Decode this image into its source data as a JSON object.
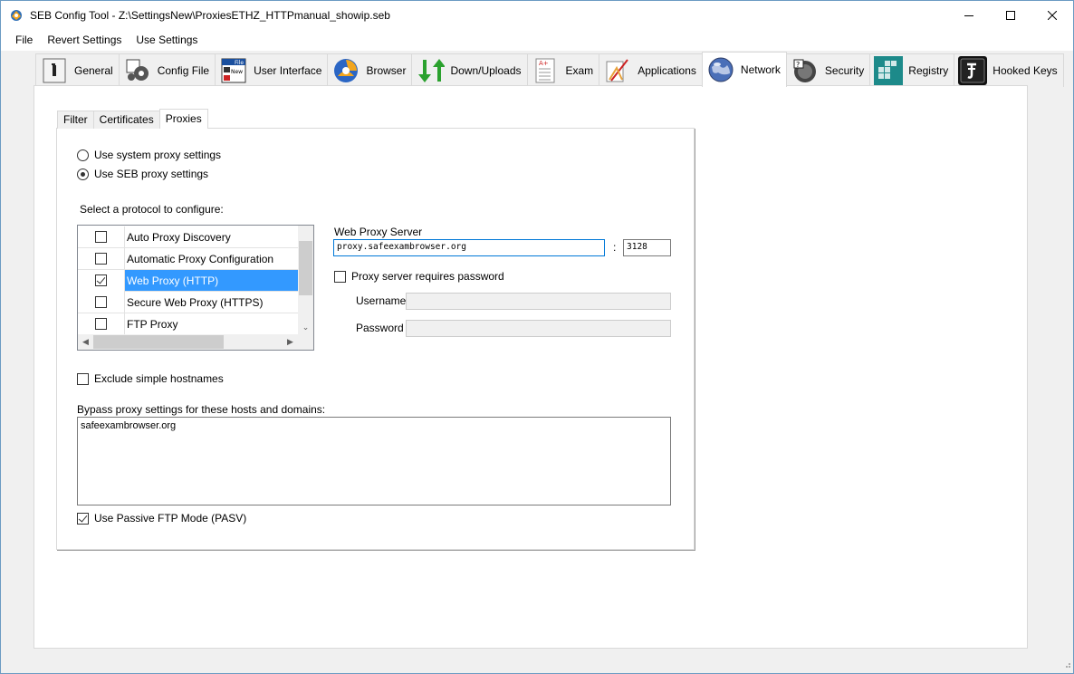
{
  "window": {
    "title": "SEB Config Tool - Z:\\SettingsNew\\ProxiesETHZ_HTTPmanual_showip.seb"
  },
  "menu": [
    "File",
    "Revert Settings",
    "Use Settings"
  ],
  "tabs": [
    {
      "label": "General",
      "icon": "general-icon"
    },
    {
      "label": "Config File",
      "icon": "config-file-icon"
    },
    {
      "label": "User Interface",
      "icon": "user-interface-icon"
    },
    {
      "label": "Browser",
      "icon": "browser-icon"
    },
    {
      "label": "Down/Uploads",
      "icon": "down-uploads-icon"
    },
    {
      "label": "Exam",
      "icon": "exam-icon"
    },
    {
      "label": "Applications",
      "icon": "applications-icon"
    },
    {
      "label": "Network",
      "icon": "network-icon",
      "active": true
    },
    {
      "label": "Security",
      "icon": "security-icon"
    },
    {
      "label": "Registry",
      "icon": "registry-icon"
    },
    {
      "label": "Hooked Keys",
      "icon": "hooked-keys-icon"
    }
  ],
  "subtabs": [
    "Filter",
    "Certificates",
    "Proxies"
  ],
  "proxies": {
    "radio_system": "Use system proxy settings",
    "radio_seb": "Use SEB proxy settings",
    "protocol_label": "Select a protocol to configure:",
    "protocols": [
      {
        "name": "Auto Proxy Discovery",
        "checked": false
      },
      {
        "name": "Automatic Proxy Configuration",
        "checked": false
      },
      {
        "name": "Web Proxy (HTTP)",
        "checked": true,
        "selected": true
      },
      {
        "name": "Secure Web Proxy (HTTPS)",
        "checked": false
      },
      {
        "name": "FTP Proxy",
        "checked": false
      }
    ],
    "server_label": "Web Proxy Server",
    "server_value": "proxy.safeexambrowser.org",
    "port_separator": ":",
    "port_value": "3128",
    "requires_password": "Proxy server requires password",
    "username_label": "Username",
    "password_label": "Password",
    "exclude_simple": "Exclude simple hostnames",
    "bypass_label": "Bypass proxy settings for these hosts and domains:",
    "bypass_value": "safeexambrowser.org",
    "passive_ftp": "Use Passive FTP Mode (PASV)"
  }
}
